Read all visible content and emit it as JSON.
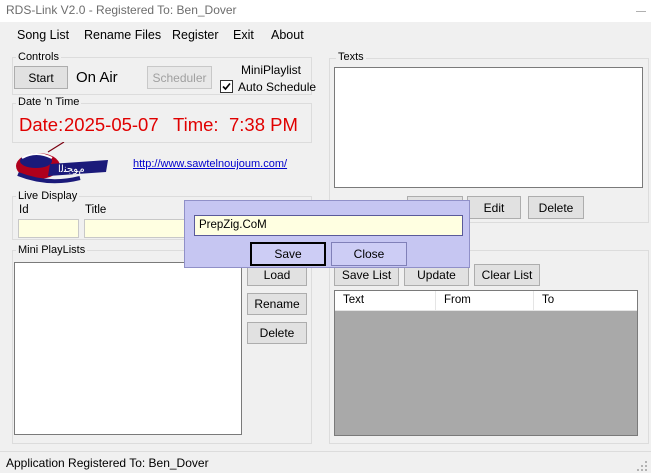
{
  "window": {
    "title": "RDS-Link V2.0 - Registered To: Ben_Dover"
  },
  "menu": {
    "items": [
      "Song List",
      "Rename Files",
      "Register",
      "Exit",
      "About"
    ]
  },
  "controls": {
    "label": "Controls",
    "start": "Start",
    "on_air": "On Air",
    "scheduler": "Scheduler",
    "mini_playlist": "MiniPlaylist",
    "auto_schedule": "Auto Schedule",
    "auto_schedule_checked": true
  },
  "datetime": {
    "label": "Date 'n Time",
    "date_label": "Date:",
    "date_value": "2025-05-07",
    "time_label": "Time:",
    "time_value": "7:38 PM",
    "color": "#e00000"
  },
  "logo": {
    "url": "http://www.sawtelnoujoum.com/"
  },
  "live_display": {
    "label": "Live Display",
    "id_label": "Id",
    "title_label": "Title"
  },
  "mini_playlists": {
    "label": "Mini PlayLists",
    "load": "Load",
    "rename": "Rename",
    "delete": "Delete"
  },
  "texts": {
    "label": "Texts",
    "edit": "Edit",
    "delete": "Delete"
  },
  "list_actions": {
    "save_list": "Save List",
    "update": "Update",
    "clear_list": "Clear List"
  },
  "table": {
    "columns": [
      "Text",
      "From",
      "To"
    ]
  },
  "dialog": {
    "input_value": "PrepZig.CoM",
    "save": "Save",
    "close": "Close"
  },
  "status": {
    "text": "Application Registered To: Ben_Dover"
  },
  "colors": {
    "dialog_bg": "#c6c6f2",
    "link": "#0000cc",
    "listview_bg": "#a9a9a9"
  }
}
